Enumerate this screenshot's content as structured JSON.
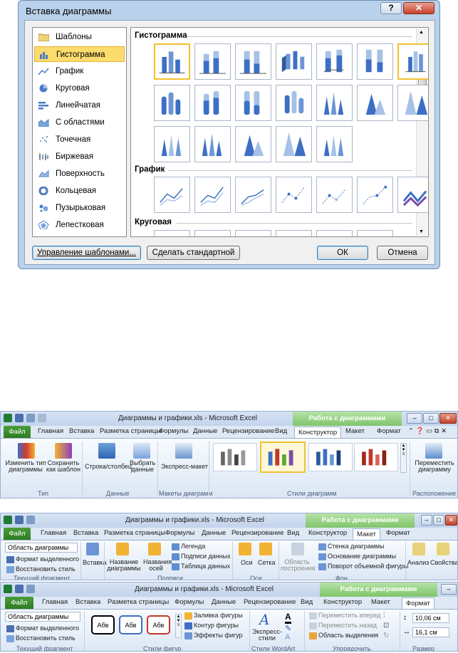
{
  "dialog": {
    "title": "Вставка диаграммы",
    "help_label": "?",
    "close_label": "✕",
    "chart_types": [
      {
        "label": "Шаблоны",
        "icon": "folder-icon",
        "selected": false
      },
      {
        "label": "Гистограмма",
        "icon": "column-chart-icon",
        "selected": true
      },
      {
        "label": "График",
        "icon": "line-chart-icon",
        "selected": false
      },
      {
        "label": "Круговая",
        "icon": "pie-chart-icon",
        "selected": false
      },
      {
        "label": "Линейчатая",
        "icon": "bar-chart-icon",
        "selected": false
      },
      {
        "label": "С областями",
        "icon": "area-chart-icon",
        "selected": false
      },
      {
        "label": "Точечная",
        "icon": "scatter-chart-icon",
        "selected": false
      },
      {
        "label": "Биржевая",
        "icon": "stock-chart-icon",
        "selected": false
      },
      {
        "label": "Поверхность",
        "icon": "surface-chart-icon",
        "selected": false
      },
      {
        "label": "Кольцевая",
        "icon": "doughnut-chart-icon",
        "selected": false
      },
      {
        "label": "Пузырьковая",
        "icon": "bubble-chart-icon",
        "selected": false
      },
      {
        "label": "Лепестковая",
        "icon": "radar-chart-icon",
        "selected": false
      }
    ],
    "sections": {
      "column": "Гистограмма",
      "line": "График",
      "pie": "Круговая"
    },
    "buttons": {
      "manage_templates": "Управление шаблонами...",
      "set_default": "Сделать стандартной",
      "ok": "ОК",
      "cancel": "Отмена"
    }
  },
  "ribbon1": {
    "title": "Диаграммы и графики.xls - Microsoft Excel",
    "context": "Работа с диаграммами",
    "tabs": [
      "Файл",
      "Главная",
      "Вставка",
      "Разметка страницы",
      "Формулы",
      "Данные",
      "Рецензирование",
      "Вид",
      "Конструктор",
      "Макет",
      "Формат"
    ],
    "active_tab": "Конструктор",
    "buttons": {
      "change_type": "Изменить тип диаграммы",
      "save_template": "Сохранить как шаблон",
      "switch_row_col": "Строка/столбец",
      "select_data": "Выбрать данные",
      "quick_layout": "Экспресс-макет",
      "move_chart": "Переместить диаграмму"
    },
    "groups": {
      "type": "Тип",
      "data": "Данные",
      "layouts": "Макеты диаграмм",
      "styles": "Стили диаграмм",
      "location": "Расположение"
    }
  },
  "ribbon2": {
    "title": "Диаграммы и графики.xls - Microsoft Excel",
    "context": "Работа с диаграммами",
    "tabs": [
      "Файл",
      "Главная",
      "Вставка",
      "Разметка страницы",
      "Формулы",
      "Данные",
      "Рецензирование",
      "Вид",
      "Конструктор",
      "Макет",
      "Формат"
    ],
    "active_tab": "Макет",
    "current_selection": "Область диаграммы",
    "format_selection": "Формат выделенного",
    "reset_style": "Восстановить стиль",
    "insert": "Вставка",
    "chart_title": "Название диаграммы",
    "axis_titles": "Названия осей",
    "legend": "Легенда",
    "data_labels": "Подписи данных",
    "data_table": "Таблица данных",
    "axes": "Оси",
    "gridlines": "Сетка",
    "plot_area": "Область построения",
    "chart_wall": "Стенка диаграммы",
    "chart_floor": "Основание диаграммы",
    "rotation": "Поворот объемной фигуры",
    "analysis": "Анализ",
    "properties": "Свойства",
    "groups": {
      "current": "Текущий фрагмент",
      "labels": "Подписи",
      "axes": "Оси",
      "background": "Фон"
    }
  },
  "ribbon3": {
    "title": "Диаграммы и графики.xls - Microsoft Excel",
    "context": "Работа с диаграммами",
    "tabs": [
      "Файл",
      "Главная",
      "Вставка",
      "Разметка страницы",
      "Формулы",
      "Данные",
      "Рецензирование",
      "Вид",
      "Конструктор",
      "Макет",
      "Формат"
    ],
    "active_tab": "Формат",
    "current_selection": "Область диаграммы",
    "format_selection": "Формат выделенного",
    "reset_style": "Восстановить стиль",
    "shape_style_sample": "Абв",
    "shape_fill": "Заливка фигуры",
    "shape_outline": "Контур фигуры",
    "shape_effects": "Эффекты фигур",
    "quick_styles": "Экспресс-стили",
    "bring_forward": "Переместить вперед",
    "send_backward": "Переместить назад",
    "selection_pane": "Область выделения",
    "height": "10,06 см",
    "width": "16,1 см",
    "groups": {
      "current": "Текущий фрагмент",
      "shape_styles": "Стили фигур",
      "wordart": "Стили WordArt",
      "arrange": "Упорядочить",
      "size": "Размер"
    }
  }
}
